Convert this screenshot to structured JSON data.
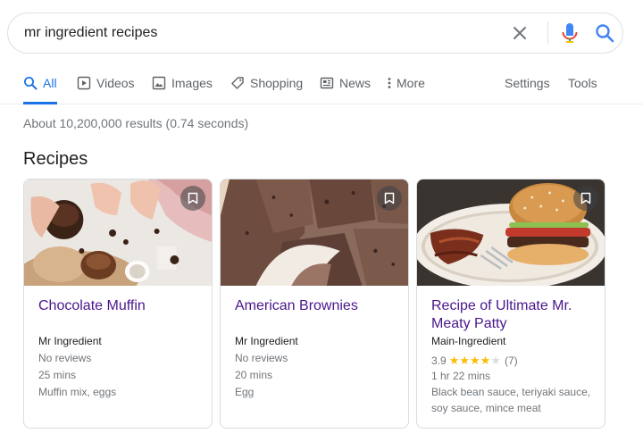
{
  "search": {
    "query": "mr ingredient recipes"
  },
  "tabs": [
    {
      "label": "All",
      "icon": "search-icon",
      "active": true
    },
    {
      "label": "Videos",
      "icon": "video-icon"
    },
    {
      "label": "Images",
      "icon": "image-icon"
    },
    {
      "label": "Shopping",
      "icon": "tag-icon"
    },
    {
      "label": "News",
      "icon": "newspaper-icon"
    },
    {
      "label": "More",
      "icon": "more-vert-icon"
    }
  ],
  "tools": {
    "settings_label": "Settings",
    "tools_label": "Tools"
  },
  "stats": "About 10,200,000 results (0.74 seconds)",
  "recipes": {
    "section_title": "Recipes",
    "cards": [
      {
        "title": "Chocolate Muffin",
        "source": "Mr Ingredient",
        "reviews": "No reviews",
        "time": "25 mins",
        "ingredients": "Muffin mix, eggs"
      },
      {
        "title": "American Brownies",
        "source": "Mr Ingredient",
        "reviews": "No reviews",
        "time": "20 mins",
        "ingredients": "Egg"
      },
      {
        "title": "Recipe of Ultimate Mr. Meaty Patty",
        "source": "Main-Ingredient",
        "rating": "3.9",
        "stars_filled": 4,
        "stars_total": 5,
        "review_count": "(7)",
        "time": "1 hr 22 mins",
        "ingredients": "Black bean sauce, teriyaki sauce, soy sauce, mince meat"
      }
    ]
  },
  "colors": {
    "accent": "#1a73e8",
    "title_link": "#4a168c",
    "secondary_text": "#70757a",
    "star": "#fbbc04"
  }
}
